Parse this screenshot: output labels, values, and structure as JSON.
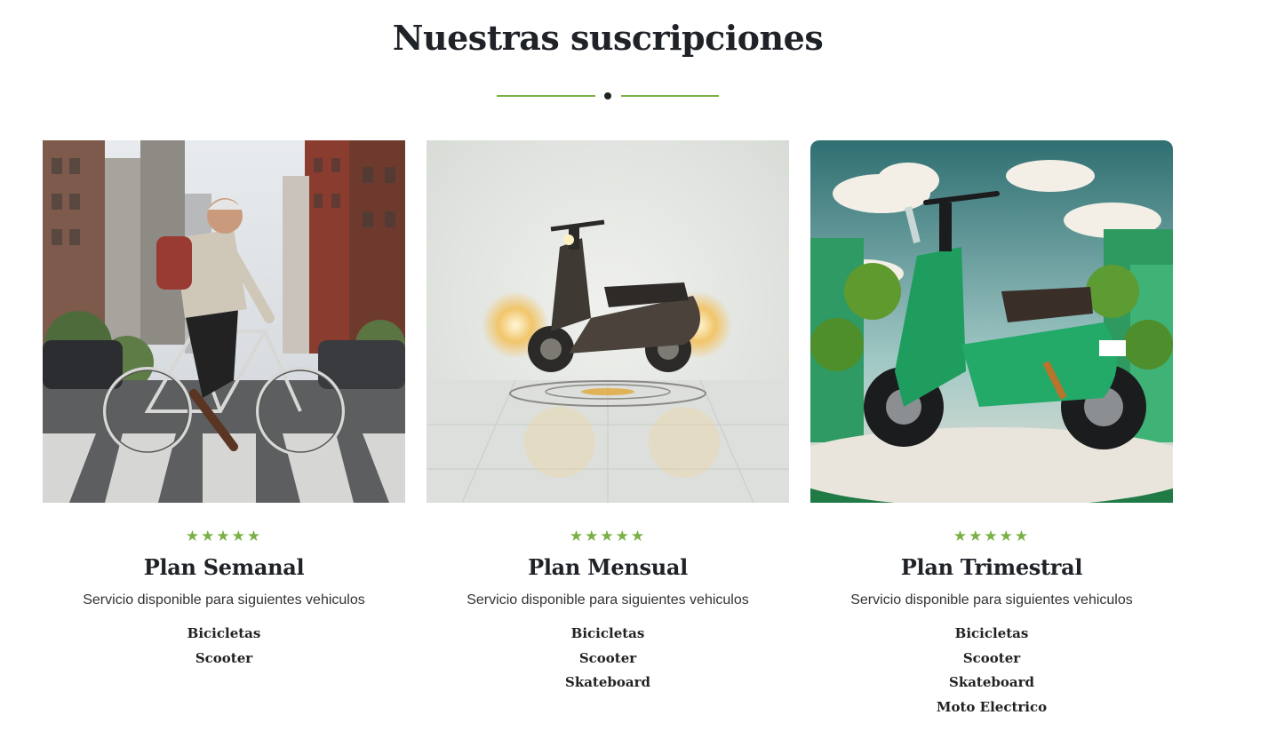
{
  "section": {
    "title": "Nuestras suscripciones"
  },
  "colors": {
    "accent": "#7ab046",
    "heading": "#1f2328"
  },
  "cards": [
    {
      "image_name": "cyclist-photo",
      "stars": "★★★★★",
      "rating": 5,
      "title": "Plan Semanal",
      "description": "Servicio disponible para siguientes vehiculos",
      "vehicles": [
        "Bicicletas",
        "Scooter"
      ]
    },
    {
      "image_name": "scooter-photo",
      "stars": "★★★★★",
      "rating": 5,
      "title": "Plan Mensual",
      "description": "Servicio disponible para siguientes vehiculos",
      "vehicles": [
        "Bicicletas",
        "Scooter",
        "Skateboard"
      ]
    },
    {
      "image_name": "green-scooter-photo",
      "stars": "★★★★★",
      "rating": 5,
      "title": "Plan Trimestral",
      "description": "Servicio disponible para siguientes vehiculos",
      "vehicles": [
        "Bicicletas",
        "Scooter",
        "Skateboard",
        "Moto Electrico"
      ]
    }
  ]
}
